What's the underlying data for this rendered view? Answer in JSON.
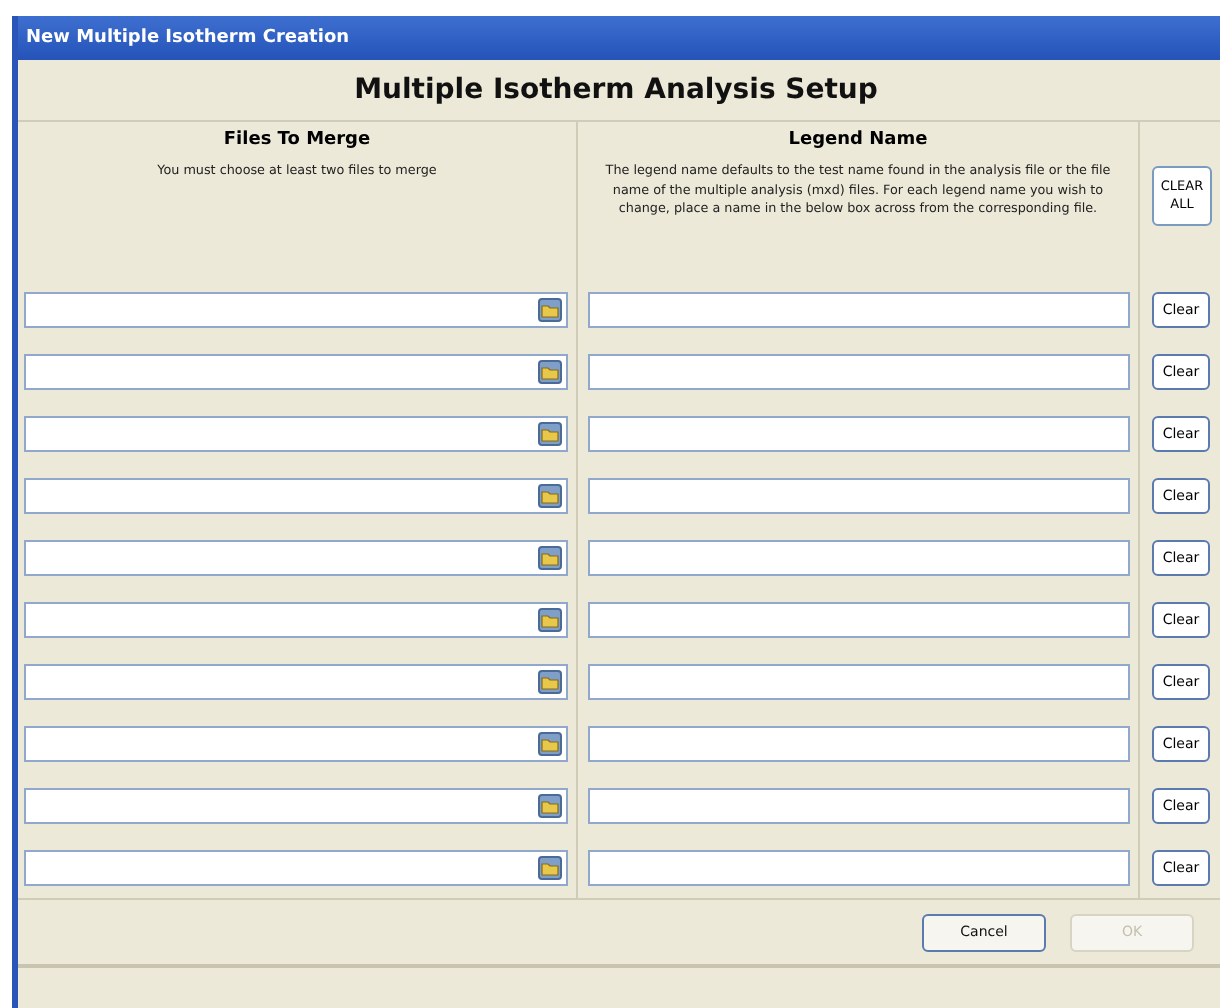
{
  "window": {
    "title": "New Multiple Isotherm Creation"
  },
  "heading": "Multiple Isotherm Analysis Setup",
  "files_column": {
    "title": "Files To Merge",
    "note": "You must choose at least two files to merge"
  },
  "legend_column": {
    "title": "Legend Name",
    "note": "The legend name defaults to the test name found in the analysis file or the file name of the multiple analysis (mxd) files. For each legend name you wish to change, place a name in the below box across from the corresponding file."
  },
  "clear_all_button": "CLEAR ALL",
  "rows": [
    {
      "clear_button": "Clear"
    },
    {
      "clear_button": "Clear"
    },
    {
      "clear_button": "Clear"
    },
    {
      "clear_button": "Clear"
    },
    {
      "clear_button": "Clear"
    },
    {
      "clear_button": "Clear"
    },
    {
      "clear_button": "Clear"
    },
    {
      "clear_button": "Clear"
    },
    {
      "clear_button": "Clear"
    },
    {
      "clear_button": "Clear"
    }
  ],
  "buttons": [
    {
      "label": "Cancel",
      "disabled": false
    },
    {
      "label": "OK",
      "disabled": true
    }
  ]
}
